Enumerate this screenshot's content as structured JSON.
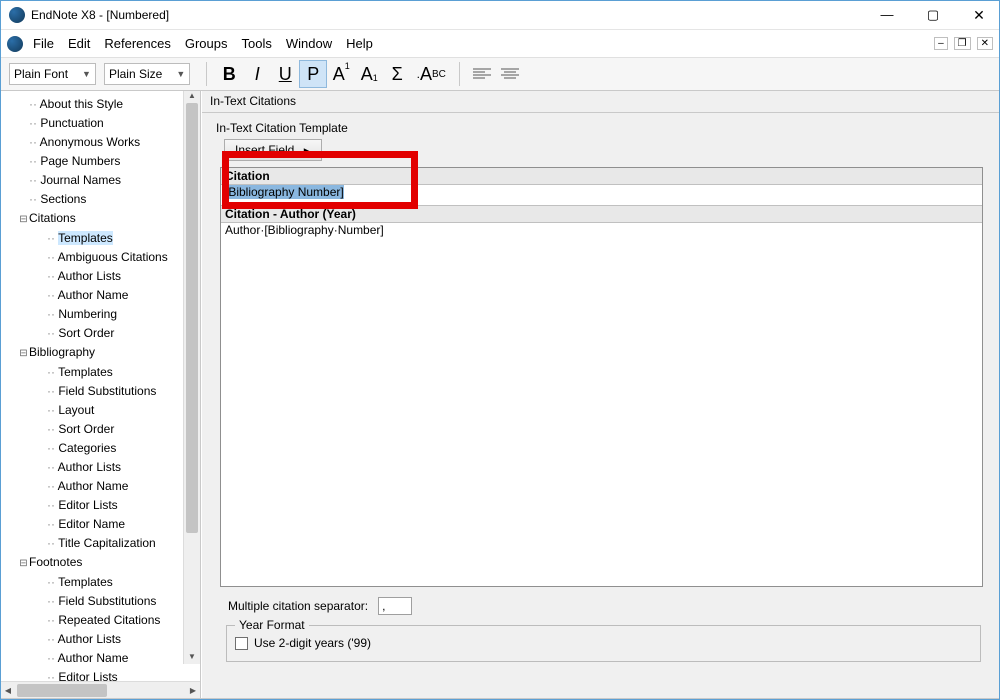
{
  "titlebar": {
    "title": "EndNote X8 - [Numbered]"
  },
  "menubar": {
    "items": [
      "File",
      "Edit",
      "References",
      "Groups",
      "Tools",
      "Window",
      "Help"
    ]
  },
  "toolbar": {
    "font_combo": "Plain Font",
    "size_combo": "Plain Size",
    "bold": "B",
    "italic": "I",
    "underline": "U",
    "plain": "P",
    "super": "A",
    "sup_exp": "1",
    "sub": "A",
    "sub_exp": "1",
    "sigma": "Σ",
    "smallcaps_pre": ".",
    "smallcaps": "A",
    "smallcaps_suf": "BC"
  },
  "tree": {
    "items": [
      {
        "label": "About this Style",
        "depth": 1,
        "toggle": ""
      },
      {
        "label": "Punctuation",
        "depth": 1,
        "toggle": ""
      },
      {
        "label": "Anonymous Works",
        "depth": 1,
        "toggle": ""
      },
      {
        "label": "Page Numbers",
        "depth": 1,
        "toggle": ""
      },
      {
        "label": "Journal Names",
        "depth": 1,
        "toggle": ""
      },
      {
        "label": "Sections",
        "depth": 1,
        "toggle": ""
      },
      {
        "label": "Citations",
        "depth": 1,
        "toggle": "−"
      },
      {
        "label": "Templates",
        "depth": 2,
        "toggle": "",
        "selected": true
      },
      {
        "label": "Ambiguous Citations",
        "depth": 2,
        "toggle": ""
      },
      {
        "label": "Author Lists",
        "depth": 2,
        "toggle": ""
      },
      {
        "label": "Author Name",
        "depth": 2,
        "toggle": ""
      },
      {
        "label": "Numbering",
        "depth": 2,
        "toggle": ""
      },
      {
        "label": "Sort Order",
        "depth": 2,
        "toggle": ""
      },
      {
        "label": "Bibliography",
        "depth": 1,
        "toggle": "−"
      },
      {
        "label": "Templates",
        "depth": 2,
        "toggle": ""
      },
      {
        "label": "Field Substitutions",
        "depth": 2,
        "toggle": ""
      },
      {
        "label": "Layout",
        "depth": 2,
        "toggle": ""
      },
      {
        "label": "Sort Order",
        "depth": 2,
        "toggle": ""
      },
      {
        "label": "Categories",
        "depth": 2,
        "toggle": ""
      },
      {
        "label": "Author Lists",
        "depth": 2,
        "toggle": ""
      },
      {
        "label": "Author Name",
        "depth": 2,
        "toggle": ""
      },
      {
        "label": "Editor Lists",
        "depth": 2,
        "toggle": ""
      },
      {
        "label": "Editor Name",
        "depth": 2,
        "toggle": ""
      },
      {
        "label": "Title Capitalization",
        "depth": 2,
        "toggle": ""
      },
      {
        "label": "Footnotes",
        "depth": 1,
        "toggle": "−"
      },
      {
        "label": "Templates",
        "depth": 2,
        "toggle": ""
      },
      {
        "label": "Field Substitutions",
        "depth": 2,
        "toggle": ""
      },
      {
        "label": "Repeated Citations",
        "depth": 2,
        "toggle": ""
      },
      {
        "label": "Author Lists",
        "depth": 2,
        "toggle": ""
      },
      {
        "label": "Author Name",
        "depth": 2,
        "toggle": ""
      },
      {
        "label": "Editor Lists",
        "depth": 2,
        "toggle": ""
      }
    ]
  },
  "main": {
    "panel_title": "In-Text Citations",
    "template_label": "In-Text Citation Template",
    "insert_field": "Insert Field",
    "citation_header": "Citation",
    "citation_value": "[Bibliography Number]",
    "citation2_header": "Citation - Author (Year)",
    "citation2_value": "Author·[Bibliography·Number]",
    "separator_label": "Multiple citation separator:",
    "separator_value": ",",
    "year_format_legend": "Year Format",
    "year_format_checkbox": "Use 2-digit years ('99)"
  }
}
